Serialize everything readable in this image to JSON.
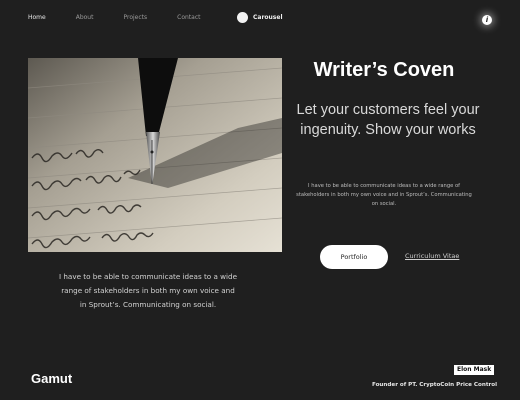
{
  "nav": {
    "items": [
      {
        "label": "Home"
      },
      {
        "label": "About"
      },
      {
        "label": "Projects"
      },
      {
        "label": "Contact"
      }
    ]
  },
  "brand": {
    "label": "Carousel"
  },
  "info": {
    "icon": "info-icon",
    "glyph": "i"
  },
  "hero": {
    "image": "fountain-pen-writing",
    "title": "Writer’s Coven",
    "subtitle": "Let your customers feel your ingenuity. Show your works",
    "body": "I have to be able to communicate ideas to a wide range of stakeholders in both my own voice and in Sprout’s. Communicating on social.",
    "primary_button": "Portfolio",
    "secondary_link": "Curriculum Vitae"
  },
  "caption": "I have to be able to communicate ideas to a wide range of stakeholders in both my own voice and in Sprout’s. Communicating on social.",
  "footer": {
    "brand": "Gamut",
    "name": "Elon Mask",
    "role": "Founder of PT. CryptoCoin Price Control"
  },
  "colors": {
    "background": "#1f1f1f",
    "text": "#ffffff",
    "button": "#ffffff"
  }
}
